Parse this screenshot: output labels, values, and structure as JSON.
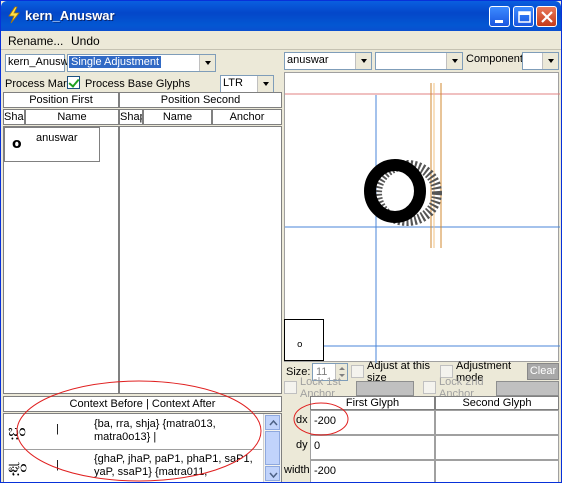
{
  "window": {
    "title": "kern_Anuswar"
  },
  "menu": {
    "rename": "Rename...",
    "undo": "Undo"
  },
  "left": {
    "lookup_value": "kern_Anusw",
    "lookup_type": "Single Adjustment",
    "process_marks_label": "Process Mark",
    "process_marks_checked": true,
    "process_base_label": "Process Base Glyphs",
    "direction": "LTR",
    "pos_first_header": "Position First",
    "pos_second_header": "Position Second",
    "col_shape": "Shap",
    "col_name": "Name",
    "col_anchor": "Anchor",
    "first_items": [
      {
        "glyph": "o",
        "name": "anuswar"
      }
    ],
    "context_header": "Context Before | Context After",
    "context_rows": [
      {
        "glyph": "ಬ಼ಂ",
        "sep": "|",
        "text": "{ba, rra, shja} {matra013, matra0o13} |"
      },
      {
        "glyph": "ಘ಼ಂ",
        "sep": "|",
        "text": "{ghaP, jhaP, paP1, phaP1, saP1, yaP, ssaP1} {matra011,"
      }
    ]
  },
  "right": {
    "glyph_select": "anuswar",
    "second_select": "",
    "component_label": "Component:",
    "component_value": "",
    "size_label": "Size:",
    "size_value": "11",
    "adjust_size_label": "Adjust at this size",
    "adjustment_mode_label": "Adjustment mode",
    "lock_first_label": "Lock 1st Anchor",
    "lock_second_label": "Lock 2nd Anchor",
    "clear_label": "Clear",
    "col_first": "First Glyph",
    "col_second": "Second Glyph",
    "rows": [
      {
        "label": "dx",
        "first": "-200",
        "second": ""
      },
      {
        "label": "dy",
        "first": "0",
        "second": ""
      },
      {
        "label": "width",
        "first": "-200",
        "second": ""
      }
    ]
  },
  "colors": {
    "highlight": "#316ac5",
    "annotation": "#e02020",
    "guide_blue": "#4a86d8",
    "guide_orange": "#d08a30",
    "guide_red": "#e08080"
  }
}
